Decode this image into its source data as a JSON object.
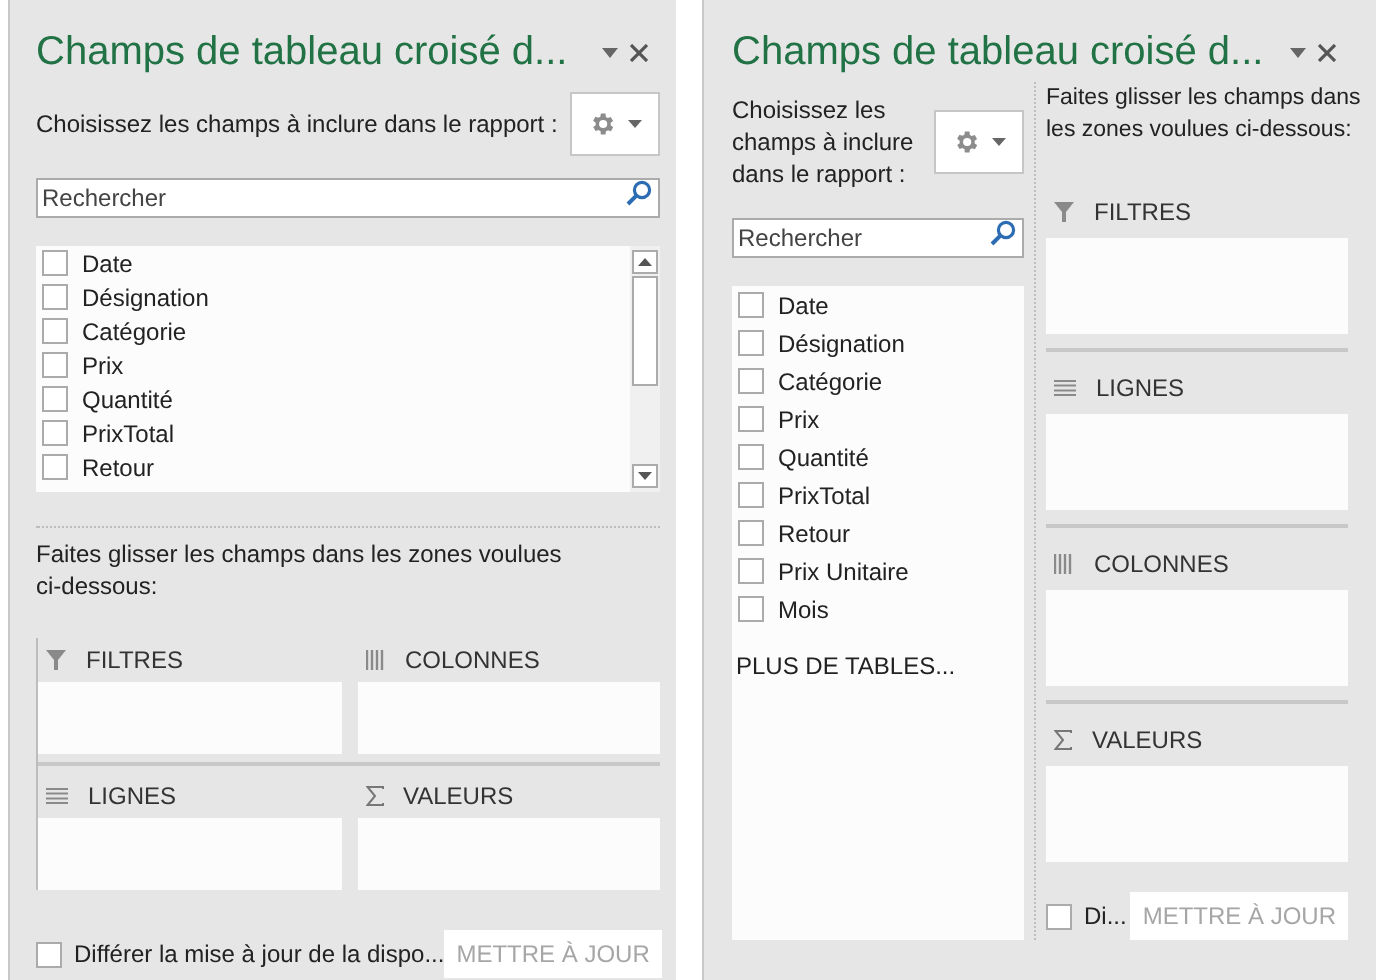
{
  "panels": [
    {
      "kind": "stacked",
      "title": "Champs de tableau croisé d...",
      "instruction": "Choisissez les champs à inclure dans le rapport :",
      "search": {
        "placeholder": "Rechercher"
      },
      "fields": [
        {
          "label": "Date",
          "checked": false
        },
        {
          "label": "Désignation",
          "checked": false
        },
        {
          "label": "Catégorie",
          "checked": false
        },
        {
          "label": "Prix",
          "checked": false
        },
        {
          "label": "Quantité",
          "checked": false
        },
        {
          "label": "PrixTotal",
          "checked": false
        },
        {
          "label": "Retour",
          "checked": false
        }
      ],
      "drop_instruction": "Faites glisser les champs dans les zones voulues ci-dessous:",
      "areas": [
        {
          "kind": "filter",
          "label": "FILTRES"
        },
        {
          "kind": "columns",
          "label": "COLONNES"
        },
        {
          "kind": "rows",
          "label": "LIGNES"
        },
        {
          "kind": "values",
          "label": "VALEURS"
        }
      ],
      "defer": {
        "label": "Différer la mise à jour de la dispo...",
        "checked": false
      },
      "update_button": {
        "label": "METTRE À JOUR",
        "disabled": true
      }
    },
    {
      "kind": "side",
      "title": "Champs de tableau croisé d...",
      "instruction": "Choisissez les champs à inclure dans le rapport :",
      "search": {
        "placeholder": "Rechercher"
      },
      "fields": [
        {
          "label": "Date",
          "checked": false
        },
        {
          "label": "Désignation",
          "checked": false
        },
        {
          "label": "Catégorie",
          "checked": false
        },
        {
          "label": "Prix",
          "checked": false
        },
        {
          "label": "Quantité",
          "checked": false
        },
        {
          "label": "PrixTotal",
          "checked": false
        },
        {
          "label": "Retour",
          "checked": false
        },
        {
          "label": "Prix Unitaire",
          "checked": false
        },
        {
          "label": "Mois",
          "checked": false
        }
      ],
      "more_tables": "PLUS DE TABLES...",
      "drop_instruction": "Faites glisser les champs dans les zones voulues ci-dessous:",
      "areas": [
        {
          "kind": "filter",
          "label": "FILTRES"
        },
        {
          "kind": "rows",
          "label": "LIGNES"
        },
        {
          "kind": "columns",
          "label": "COLONNES"
        },
        {
          "kind": "values",
          "label": "VALEURS"
        }
      ],
      "defer": {
        "label": "Di...",
        "checked": false
      },
      "update_button": {
        "label": "METTRE À JOUR",
        "disabled": true
      }
    }
  ]
}
